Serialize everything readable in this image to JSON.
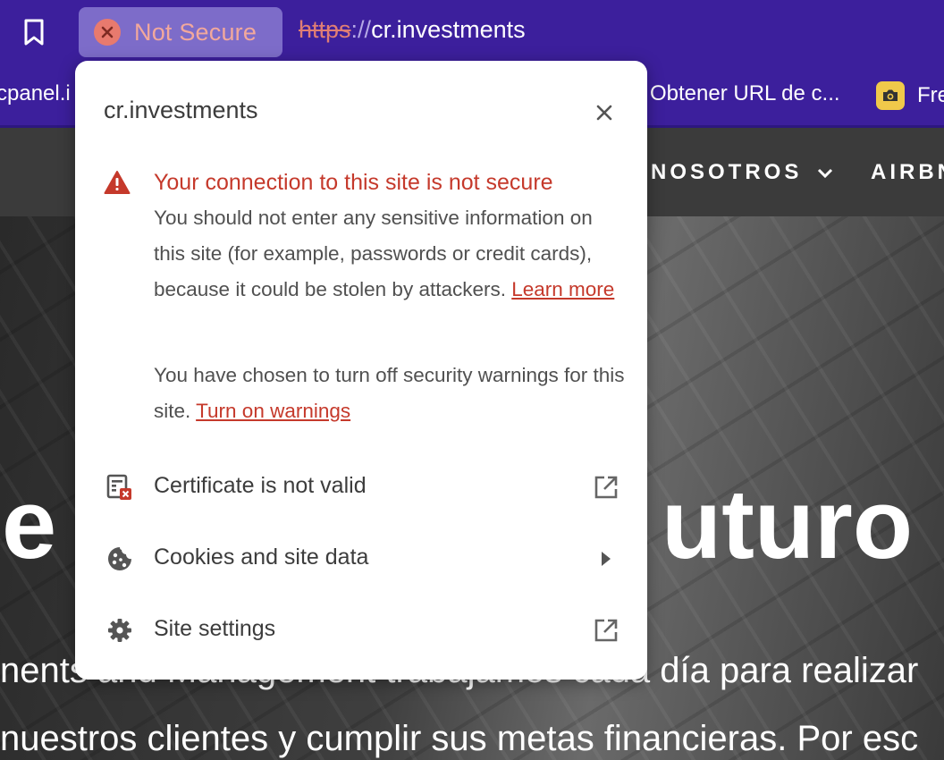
{
  "browser": {
    "security_chip_label": "Not Secure",
    "url_scheme": "https",
    "url_separator": "://",
    "url_host": "cr.investments",
    "bookmarks": [
      {
        "label": "cpanel.i"
      },
      {
        "label": "Obtener URL de c..."
      },
      {
        "label": "Fre"
      }
    ]
  },
  "site": {
    "nav": [
      "NOSOTROS",
      "AIRBN"
    ],
    "hero_title_left": "e",
    "hero_title_right": "uturo",
    "hero_line_1": "nents and Management trabajamos cada día para realizar",
    "hero_line_2": "nuestros clientes y cumplir sus metas financieras. Por esc"
  },
  "popup": {
    "domain": "cr.investments",
    "warning_heading": "Your connection to this site is not secure",
    "warning_body": "You should not enter any sensitive information on this site (for example, passwords or credit cards), because it could be stolen by attackers.",
    "learn_more": "Learn more",
    "warnings_off_text": "You have chosen to turn off security warnings for this site.",
    "turn_on_warnings": "Turn on warnings",
    "rows": [
      {
        "label": "Certificate is not valid",
        "icon": "certificate-error-icon",
        "trail": "external-link-icon"
      },
      {
        "label": "Cookies and site data",
        "icon": "cookie-icon",
        "trail": "arrow-right-icon"
      },
      {
        "label": "Site settings",
        "icon": "gear-icon",
        "trail": "external-link-icon"
      }
    ]
  },
  "colors": {
    "chrome": "#3c1f9c",
    "danger": "#c5392b",
    "chip": "#7d6cc9"
  }
}
